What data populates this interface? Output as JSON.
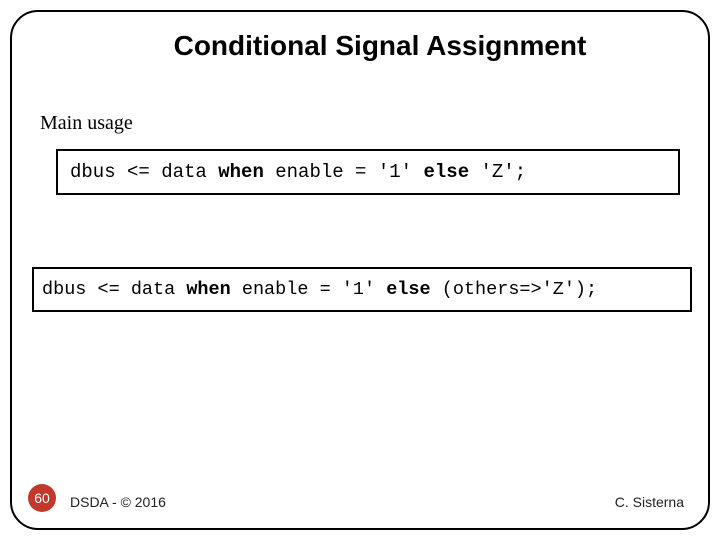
{
  "title": "Conditional Signal Assignment",
  "subheading": "Main usage",
  "code1": {
    "p1": "dbus <= data ",
    "kw1": "when",
    "p2": " enable = '1' ",
    "kw2": "else",
    "p3": " 'Z';"
  },
  "code2": {
    "p1": "dbus <= data ",
    "kw1": "when",
    "p2": " enable = '1' ",
    "kw2": "else",
    "p3": " (others=>'Z');"
  },
  "slide_number": "60",
  "footer_left": "DSDA - © 2016",
  "footer_right": "C. Sisterna"
}
